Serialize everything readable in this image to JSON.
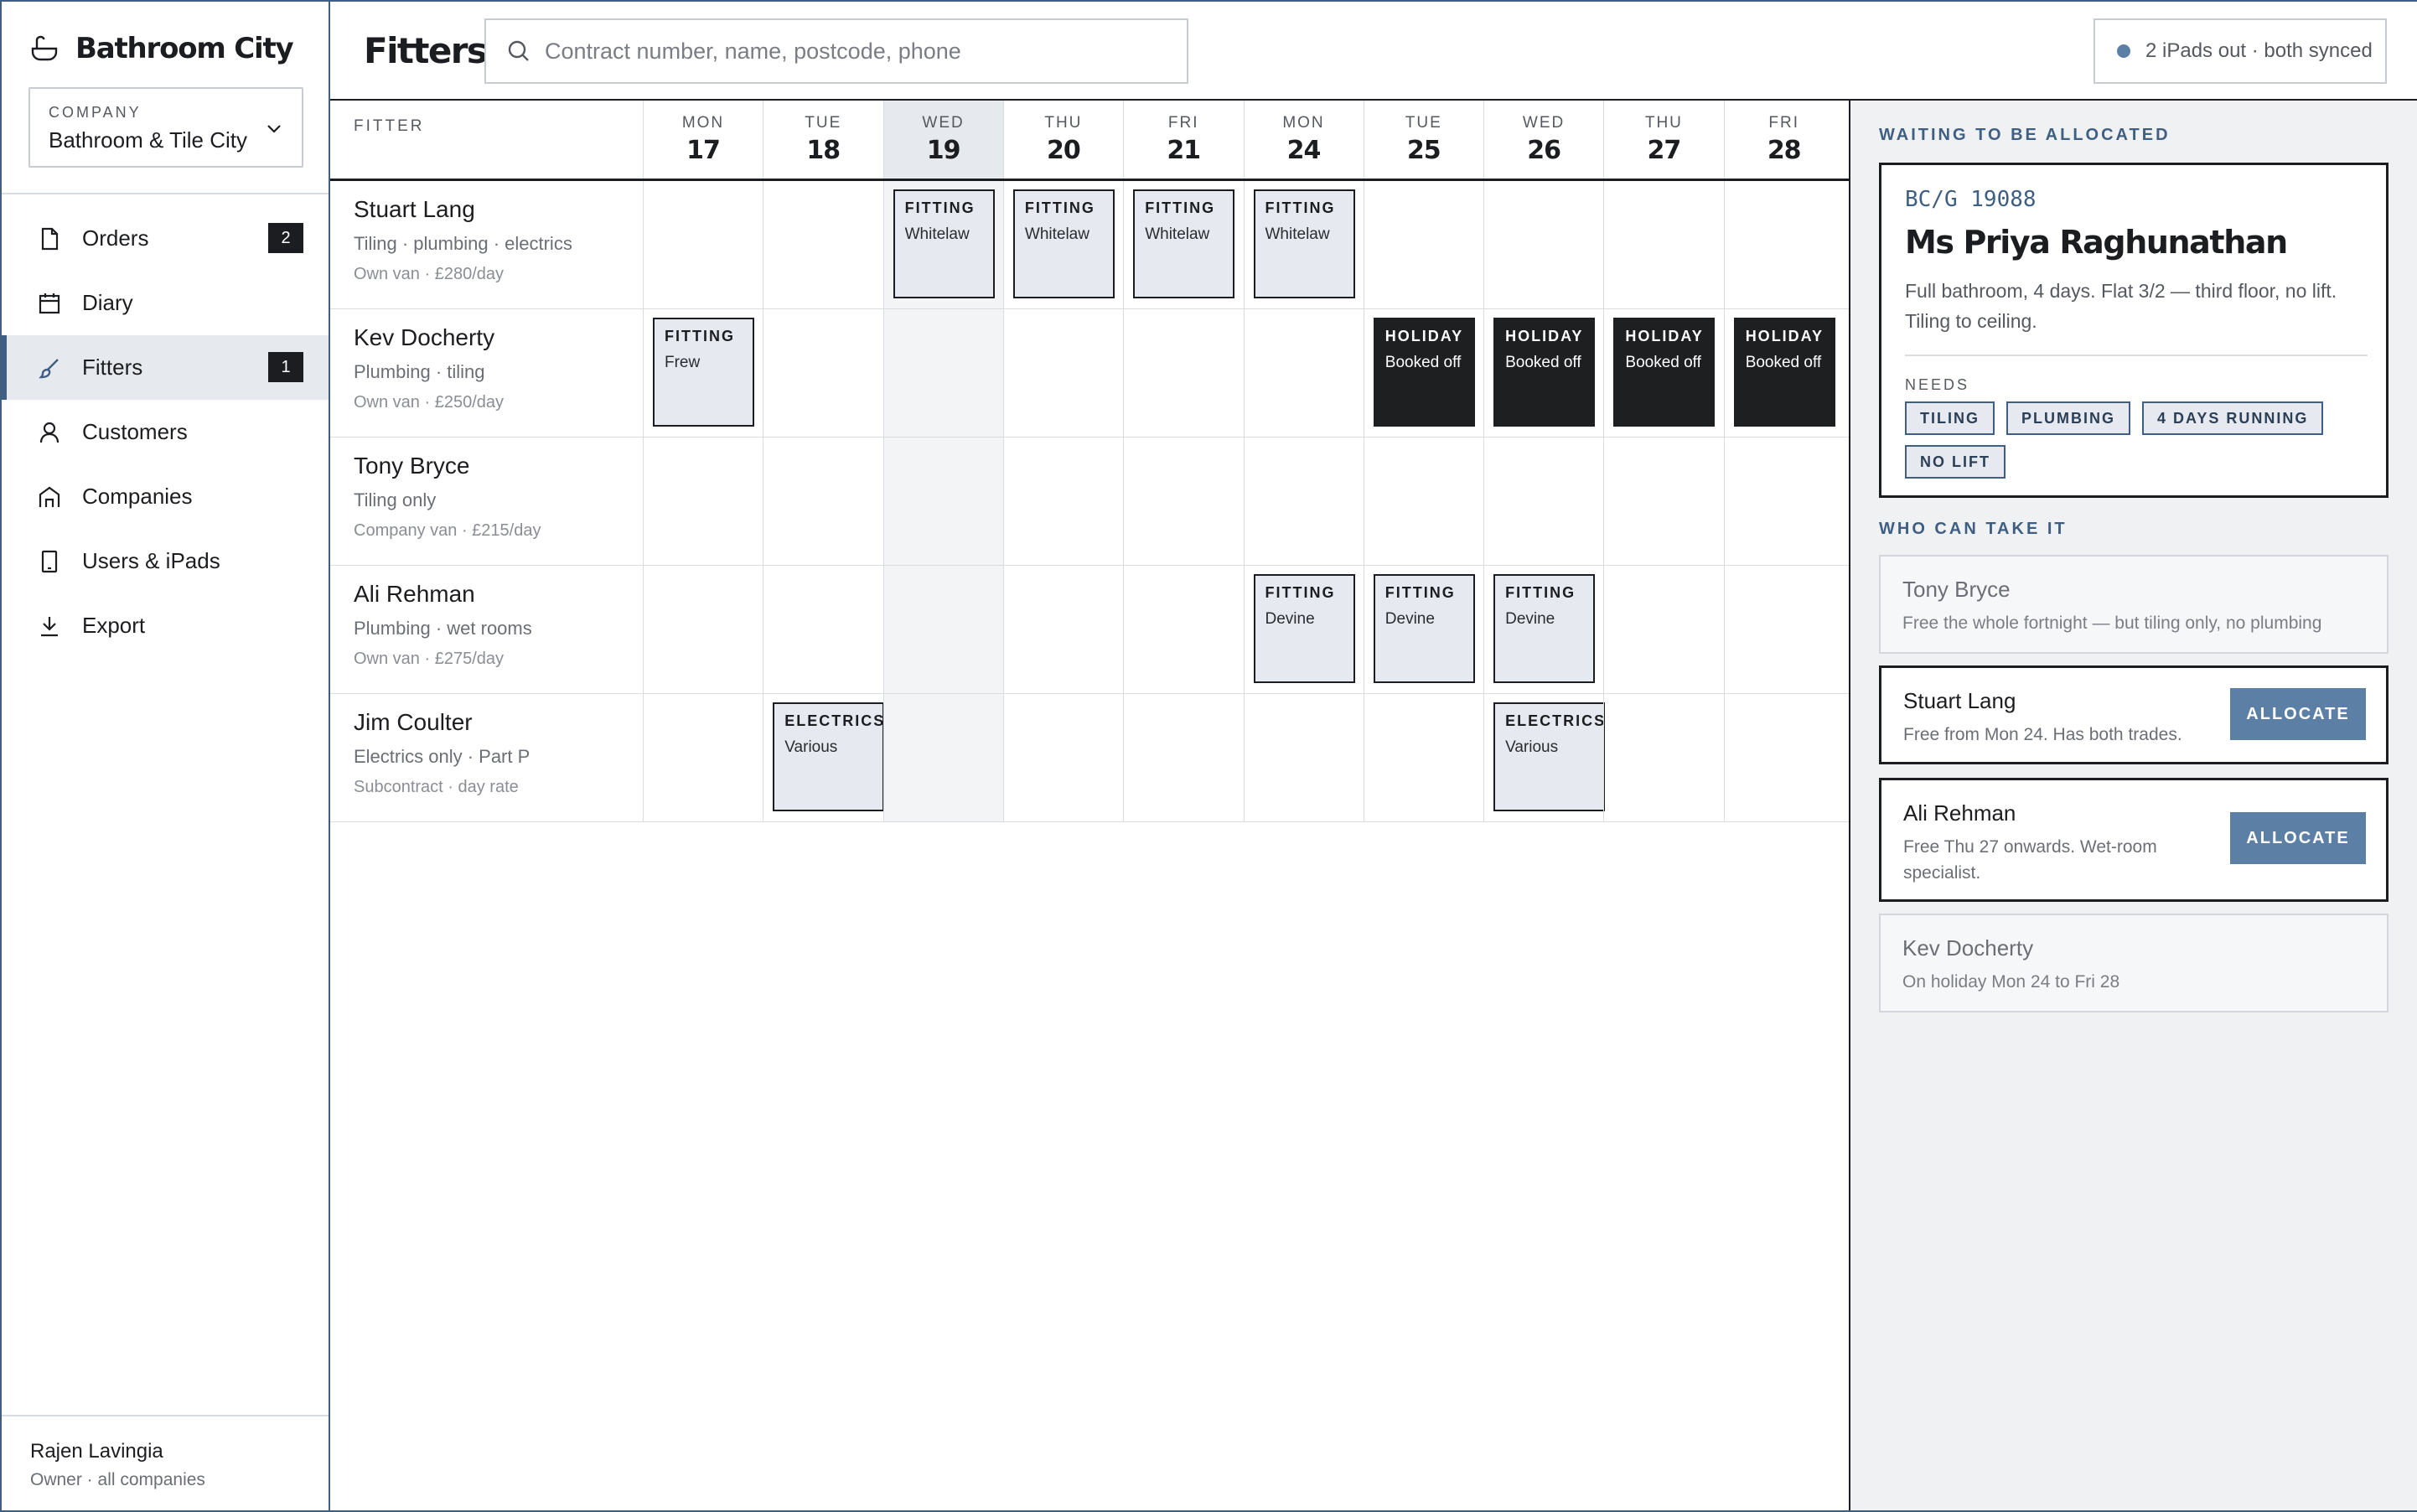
{
  "sidebar": {
    "brand": "Bathroom City",
    "company_label": "COMPANY",
    "company_value": "Bathroom & Tile City",
    "nav": [
      {
        "label": "Orders",
        "icon": "document-icon",
        "badge": "2"
      },
      {
        "label": "Diary",
        "icon": "calendar-icon",
        "badge": ""
      },
      {
        "label": "Fitters",
        "icon": "brush-icon",
        "badge": "1",
        "active": true
      },
      {
        "label": "Customers",
        "icon": "person-icon",
        "badge": ""
      },
      {
        "label": "Companies",
        "icon": "building-icon",
        "badge": ""
      },
      {
        "label": "Users & iPads",
        "icon": "tablet-icon",
        "badge": ""
      },
      {
        "label": "Export",
        "icon": "download-icon",
        "badge": ""
      }
    ],
    "user": {
      "name": "Rajen Lavingia",
      "role": "Owner · all companies"
    }
  },
  "header": {
    "title": "Fitters",
    "search_placeholder": "Contract number, name, postcode, phone",
    "sync_status": "2 iPads out · both synced"
  },
  "grid": {
    "fitter_column_label": "FITTER",
    "days": [
      {
        "dow": "MON",
        "num": "17"
      },
      {
        "dow": "TUE",
        "num": "18"
      },
      {
        "dow": "WED",
        "num": "19",
        "today": true
      },
      {
        "dow": "THU",
        "num": "20"
      },
      {
        "dow": "FRI",
        "num": "21"
      },
      {
        "dow": "MON",
        "num": "24"
      },
      {
        "dow": "TUE",
        "num": "25"
      },
      {
        "dow": "WED",
        "num": "26"
      },
      {
        "dow": "THU",
        "num": "27"
      },
      {
        "dow": "FRI",
        "num": "28"
      }
    ],
    "fitters": [
      {
        "name": "Stuart Lang",
        "trades": "Tiling · plumbing · electrics",
        "terms": "Own van · £280/day",
        "bookings": [
          {
            "day": 2,
            "type": "FITTING",
            "note": "Whitelaw"
          },
          {
            "day": 3,
            "type": "FITTING",
            "note": "Whitelaw"
          },
          {
            "day": 4,
            "type": "FITTING",
            "note": "Whitelaw"
          },
          {
            "day": 5,
            "type": "FITTING",
            "note": "Whitelaw"
          }
        ]
      },
      {
        "name": "Kev Docherty",
        "trades": "Plumbing · tiling",
        "terms": "Own van · £250/day",
        "bookings": [
          {
            "day": 0,
            "type": "FITTING",
            "note": "Frew"
          },
          {
            "day": 6,
            "type": "HOLIDAY",
            "note": "Booked off",
            "holiday": true
          },
          {
            "day": 7,
            "type": "HOLIDAY",
            "note": "Booked off",
            "holiday": true
          },
          {
            "day": 8,
            "type": "HOLIDAY",
            "note": "Booked off",
            "holiday": true
          },
          {
            "day": 9,
            "type": "HOLIDAY",
            "note": "Booked off",
            "holiday": true
          }
        ]
      },
      {
        "name": "Tony Bryce",
        "trades": "Tiling only",
        "terms": "Company van · £215/day",
        "bookings": []
      },
      {
        "name": "Ali Rehman",
        "trades": "Plumbing · wet rooms",
        "terms": "Own van · £275/day",
        "bookings": [
          {
            "day": 5,
            "type": "FITTING",
            "note": "Devine"
          },
          {
            "day": 6,
            "type": "FITTING",
            "note": "Devine"
          },
          {
            "day": 7,
            "type": "FITTING",
            "note": "Devine"
          }
        ]
      },
      {
        "name": "Jim Coulter",
        "trades": "Electrics only · Part P",
        "terms": "Subcontract · day rate",
        "bookings": [
          {
            "day": 1,
            "type": "ELECTRICS",
            "note": "Various",
            "wide": true
          },
          {
            "day": 7,
            "type": "ELECTRICS",
            "note": "Various",
            "wide": true
          }
        ]
      }
    ]
  },
  "panel": {
    "waiting_heading": "WAITING TO BE ALLOCATED",
    "order": {
      "ref": "BC/G 19088",
      "customer": "Ms Priya Raghunathan",
      "description": "Full bathroom, 4 days. Flat 3/2 — third floor, no lift. Tiling to ceiling.",
      "needs_label": "NEEDS",
      "needs": [
        "TILING",
        "PLUMBING",
        "4 DAYS RUNNING",
        "NO LIFT"
      ]
    },
    "candidates_heading": "WHO CAN TAKE IT",
    "candidates": [
      {
        "name": "Tony Bryce",
        "note": "Free the whole fortnight — but tiling only, no plumbing",
        "available": false
      },
      {
        "name": "Stuart Lang",
        "note": "Free from Mon 24. Has both trades.",
        "available": true,
        "action": "ALLOCATE"
      },
      {
        "name": "Ali Rehman",
        "note": "Free Thu 27 onwards. Wet-room specialist.",
        "available": true,
        "action": "ALLOCATE"
      },
      {
        "name": "Kev Docherty",
        "note": "On holiday Mon 24 to Fri 28",
        "available": false
      }
    ]
  }
}
